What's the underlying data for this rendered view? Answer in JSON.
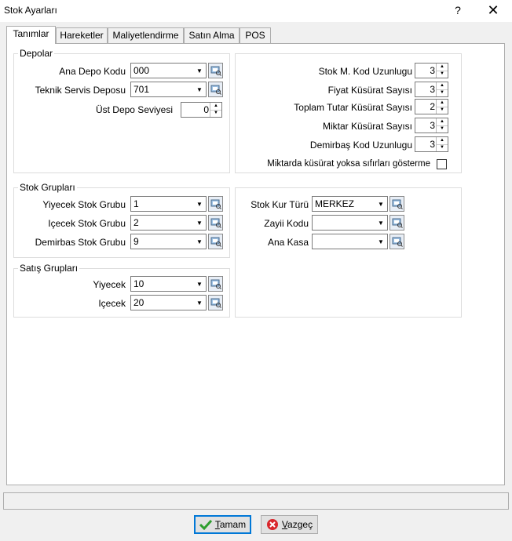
{
  "window": {
    "title": "Stok Ayarları",
    "help": "?",
    "close": "✕"
  },
  "tabs": [
    "Tanımlar",
    "Hareketler",
    "Maliyetlendirme",
    "Satın Alma",
    "POS"
  ],
  "depolar": {
    "legend": "Depolar",
    "ana_depo": {
      "label": "Ana Depo Kodu",
      "value": "000"
    },
    "teknik_servis": {
      "label": "Teknik Servis Deposu",
      "value": "701"
    },
    "ust_depo": {
      "label": "Üst Depo Seviyesi",
      "value": "0"
    }
  },
  "formats": {
    "kod_uzunlugu": {
      "label": "Stok M. Kod Uzunlugu",
      "value": "3"
    },
    "fiyat_kusurat": {
      "label": "Fiyat Küsürat Sayısı",
      "value": "3"
    },
    "toplam_tutar": {
      "label": "Toplam Tutar Küsürat Sayısı",
      "value": "2"
    },
    "miktar_kusurat": {
      "label": "Miktar Küsürat Sayısı",
      "value": "3"
    },
    "demirbas_kod": {
      "label": "Demirbaş Kod Uzunlugu",
      "value": "3"
    },
    "hide_zero_fraction": {
      "label": "Miktarda küsürat yoksa sıfırları gösterme",
      "checked": false
    }
  },
  "stok_gruplari": {
    "legend": "Stok Grupları",
    "yiyecek": {
      "label": "Yiyecek Stok Grubu",
      "value": "1"
    },
    "icecek": {
      "label": "Içecek Stok Grubu",
      "value": "2"
    },
    "demirbas": {
      "label": "Demirbas Stok Grubu",
      "value": "9"
    }
  },
  "satis_gruplari": {
    "legend": "Satış Grupları",
    "yiyecek": {
      "label": "Yiyecek",
      "value": "10"
    },
    "icecek": {
      "label": "Içecek",
      "value": "20"
    }
  },
  "kur": {
    "stok_kur_turu": {
      "label": "Stok Kur Türü",
      "value": "MERKEZ"
    },
    "zayii_kodu": {
      "label": "Zayii Kodu",
      "value": ""
    },
    "ana_kasa": {
      "label": "Ana Kasa",
      "value": ""
    }
  },
  "buttons": {
    "ok_first": "T",
    "ok_rest": "amam",
    "cancel_first": "V",
    "cancel_rest": "azgeç"
  },
  "colors": {
    "ok_check": "#2e9e2e",
    "cancel_icon": "#d9262b",
    "focus_border": "#0078d7"
  }
}
